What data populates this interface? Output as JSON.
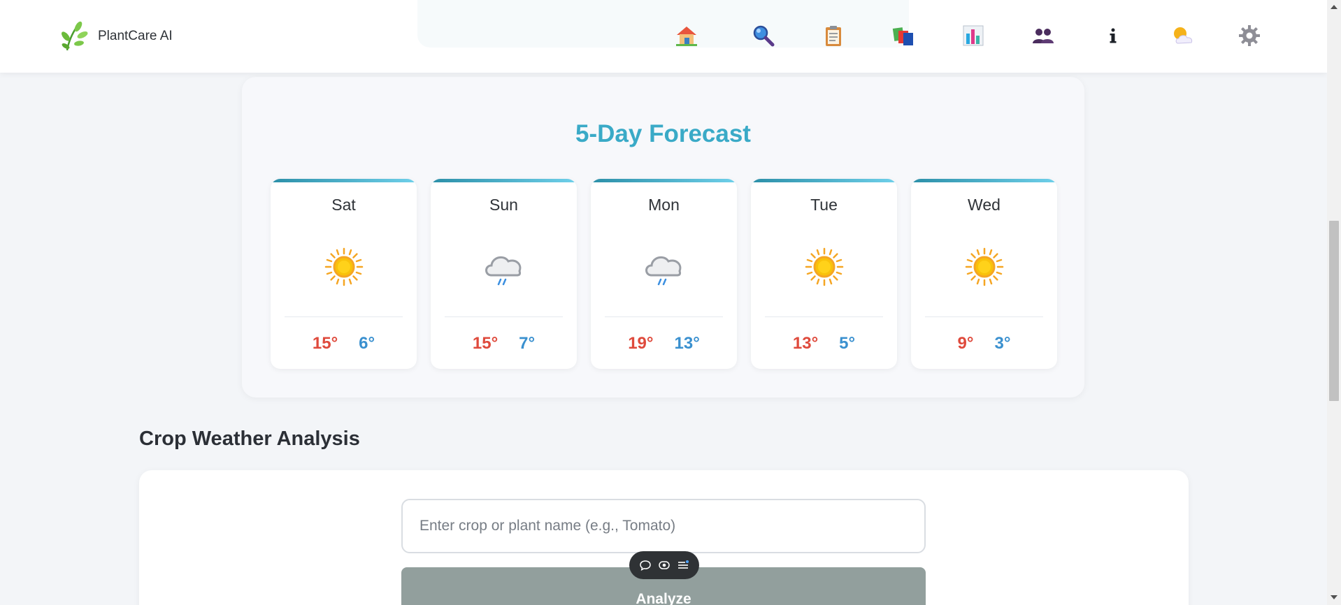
{
  "app": {
    "name": "PlantCare AI",
    "logo_icon": "leaf-sprig-icon"
  },
  "nav": {
    "items": [
      {
        "icon": "home-icon"
      },
      {
        "icon": "magnifier-icon"
      },
      {
        "icon": "clipboard-icon"
      },
      {
        "icon": "books-icon"
      },
      {
        "icon": "bar-chart-icon"
      },
      {
        "icon": "users-icon"
      },
      {
        "icon": "info-icon"
      },
      {
        "icon": "weather-icon"
      },
      {
        "icon": "gear-icon"
      }
    ]
  },
  "forecast": {
    "title": "5-Day Forecast",
    "days": [
      {
        "day": "Sat",
        "icon": "sun-icon",
        "high": "15°",
        "low": "6°"
      },
      {
        "day": "Sun",
        "icon": "rain-cloud-icon",
        "high": "15°",
        "low": "7°"
      },
      {
        "day": "Mon",
        "icon": "rain-cloud-icon",
        "high": "19°",
        "low": "13°"
      },
      {
        "day": "Tue",
        "icon": "sun-icon",
        "high": "13°",
        "low": "5°"
      },
      {
        "day": "Wed",
        "icon": "sun-icon",
        "high": "9°",
        "low": "3°"
      }
    ]
  },
  "crop_analysis": {
    "title": "Crop Weather Analysis",
    "input_placeholder": "Enter crop or plant name (e.g., Tomato)",
    "input_value": "",
    "analyze_label": "Analyze"
  },
  "floating_toolbar": {
    "icons": [
      "chat-bubble-icon",
      "eye-icon",
      "menu-list-icon"
    ]
  },
  "colors": {
    "accent": "#3aaac7",
    "high_temp": "#df4a3c",
    "low_temp": "#3a90cf",
    "button_disabled": "#929f9d"
  }
}
